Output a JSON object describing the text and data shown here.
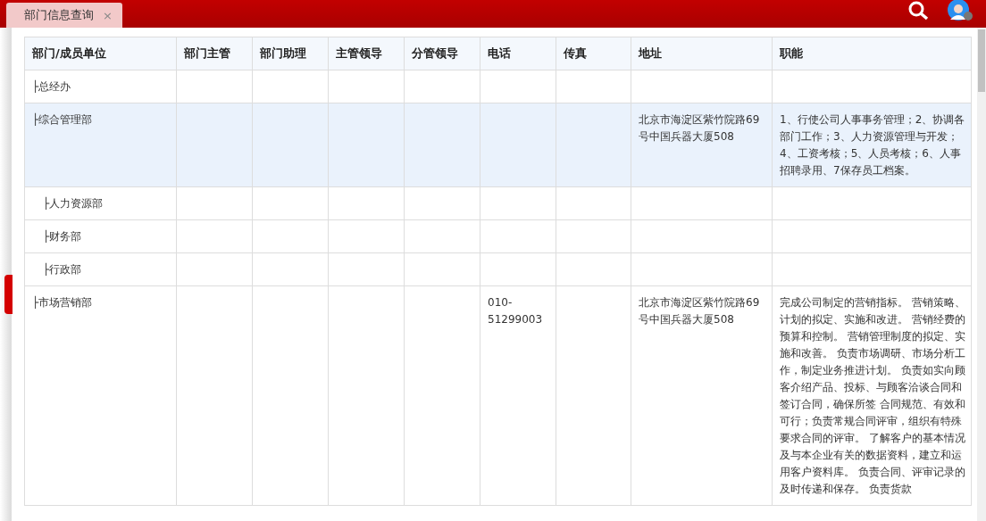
{
  "tabs": [
    {
      "label": "部门信息查询",
      "close": "×",
      "selected": true
    }
  ],
  "table": {
    "columns": [
      "部门/成员单位",
      "部门主管",
      "部门助理",
      "主管领导",
      "分管领导",
      "电话",
      "传真",
      "地址",
      "职能"
    ],
    "rows": [
      {
        "selected": false,
        "cells": [
          "├总经办",
          "",
          "",
          "",
          "",
          "",
          "",
          "",
          ""
        ]
      },
      {
        "selected": true,
        "cells": [
          "├综合管理部",
          "",
          "",
          "",
          "",
          "",
          "",
          "北京市海淀区紫竹院路69号中国兵器大厦508",
          "1、行使公司人事事务管理；2、协调各部门工作；3、人力资源管理与开发；4、工资考核；5、人员考核；6、人事招聘录用、7保存员工档案。"
        ],
        "children": [
          {
            "selected": false,
            "cells": [
              "├人力资源部",
              "",
              "",
              "",
              "",
              "",
              "",
              "",
              ""
            ]
          },
          {
            "selected": false,
            "cells": [
              "├财务部",
              "",
              "",
              "",
              "",
              "",
              "",
              "",
              ""
            ]
          },
          {
            "selected": false,
            "cells": [
              "├行政部",
              "",
              "",
              "",
              "",
              "",
              "",
              "",
              ""
            ]
          }
        ]
      },
      {
        "selected": false,
        "cells": [
          "├市场营销部",
          "",
          "",
          "",
          "",
          "010-51299003",
          "",
          "北京市海淀区紫竹院路69号中国兵器大厦508",
          "完成公司制定的营销指标。 营销策略、计划的拟定、实施和改进。 营销经费的预算和控制。 营销管理制度的拟定、实施和改善。 负责市场调研、市场分析工作，制定业务推进计划。 负责如实向顾客介绍产品、投标、与顾客洽谈合同和签订合同，确保所签 合同规范、有效和可行；负责常规合同评审，组织有特殊要求合同的评审。 了解客户的基本情况及与本企业有关的数据资料，建立和运用客户资料库。 负责合同、评审记录的及时传递和保存。 负责货款"
        ]
      }
    ]
  }
}
